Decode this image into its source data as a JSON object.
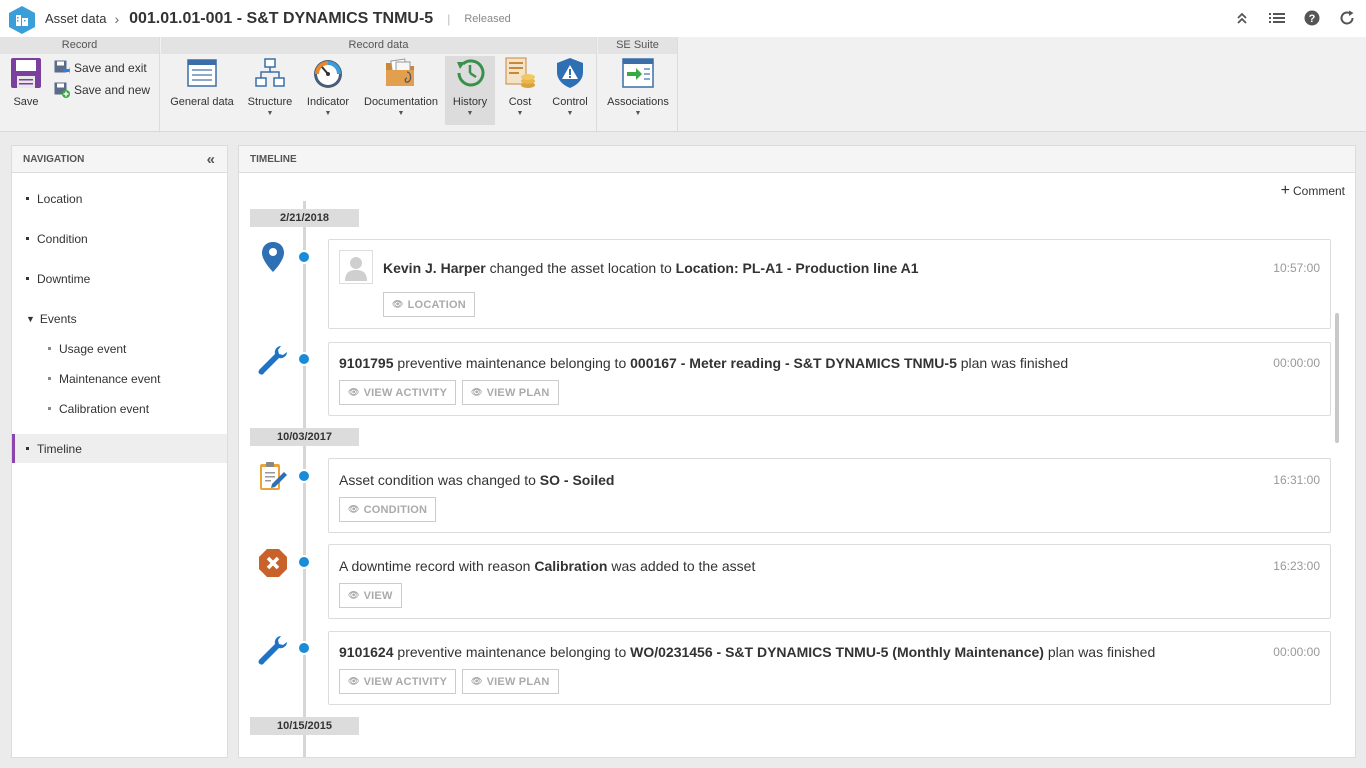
{
  "header": {
    "app_name": "Asset data",
    "record_title": "001.01.01-001 - S&T DYNAMICS TNMU-5",
    "divider": "|",
    "status": "Released"
  },
  "ribbon": {
    "record_group": "Record",
    "record_data_group": "Record data",
    "se_suite_group": "SE Suite",
    "save": "Save",
    "save_and_exit": "Save and exit",
    "save_and_new": "Save and new",
    "general_data": "General data",
    "structure": "Structure",
    "indicator": "Indicator",
    "documentation": "Documentation",
    "history": "History",
    "cost": "Cost",
    "control": "Control",
    "associations": "Associations"
  },
  "navigation": {
    "title": "NAVIGATION",
    "items": [
      {
        "label": "Location"
      },
      {
        "label": "Condition"
      },
      {
        "label": "Downtime"
      },
      {
        "label": "Events"
      },
      {
        "label": "Usage event"
      },
      {
        "label": "Maintenance event"
      },
      {
        "label": "Calibration event"
      },
      {
        "label": "Timeline"
      }
    ]
  },
  "timeline": {
    "title": "TIMELINE",
    "comment_button": "Comment",
    "dates": [
      "2/21/2018",
      "10/03/2017",
      "10/15/2015"
    ],
    "events": [
      {
        "icon": "location-pin-icon",
        "t1": "Kevin J. Harper",
        "t2": " changed the asset location to ",
        "t3": "Location: PL-A1 - Production line A1",
        "time": "10:57:00",
        "btn1": "LOCATION"
      },
      {
        "icon": "wrench-icon",
        "t1": "9101795",
        "t2": " preventive maintenance belonging to ",
        "t3": "000167 - Meter reading - S&T DYNAMICS TNMU-5",
        "t4": " plan was finished",
        "time": "00:00:00",
        "btn1": "VIEW ACTIVITY",
        "btn2": "VIEW PLAN"
      },
      {
        "icon": "clipboard-edit-icon",
        "t1": "Asset condition was changed to ",
        "t2": "SO - Soiled",
        "time": "16:31:00",
        "btn1": "CONDITION"
      },
      {
        "icon": "downtime-icon",
        "t1": "A downtime record with reason ",
        "t2": "Calibration",
        "t3": " was added to the asset",
        "time": "16:23:00",
        "btn1": "VIEW"
      },
      {
        "icon": "wrench-icon",
        "t1": "9101624",
        "t2": " preventive maintenance belonging to ",
        "t3": "WO/0231456 - S&T DYNAMICS TNMU-5 (Monthly Maintenance)",
        "t4": " plan was finished",
        "time": "00:00:00",
        "btn1": "VIEW ACTIVITY",
        "btn2": "VIEW PLAN"
      }
    ]
  },
  "colors": {
    "accent_blue": "#1a8bd8",
    "nav_active": "#8e44ad"
  }
}
